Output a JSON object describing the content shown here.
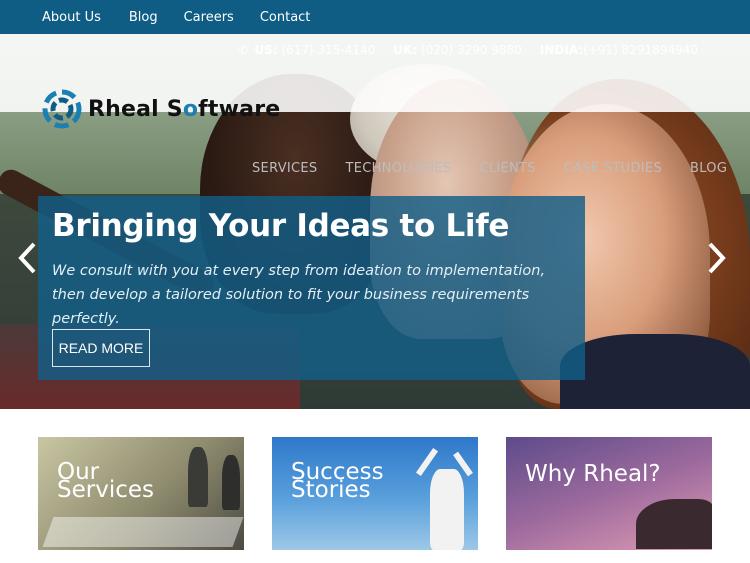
{
  "topnav": {
    "items": [
      "About Us",
      "Blog",
      "Careers",
      "Contact"
    ]
  },
  "contact": {
    "us_label": "US:",
    "us_number": "(617) 315-4140",
    "uk_label": "UK:",
    "uk_number": "(020) 3290 9880",
    "india_label": "INDIA:",
    "india_number": "(+91) 8291894940",
    "icon": "phone-icon"
  },
  "brand": {
    "name_part1": "Rheal S",
    "name_o": "o",
    "name_part2": "ftware",
    "accent": "#1a7fb2"
  },
  "mainnav": {
    "items": [
      "SERVICES",
      "TECHNOLOGIES",
      "CLIENTS",
      "CASE STUDIES",
      "BLOG"
    ]
  },
  "hero": {
    "title": "Bringing Your Ideas to Life",
    "subtitle": "We consult with you at every step from ideation to implementation, then develop a tailored solution to fit your business requirements perfectly.",
    "button": "READ MORE",
    "prev_icon": "chevron-left-icon",
    "next_icon": "chevron-right-icon"
  },
  "cards": [
    {
      "line1": "Our",
      "line2": "Services"
    },
    {
      "line1": "Success",
      "line2": "Stories"
    },
    {
      "line1": "Why Rheal?"
    }
  ],
  "colors": {
    "topbar": "#0f5d84",
    "caption_bg": "#125e88"
  }
}
